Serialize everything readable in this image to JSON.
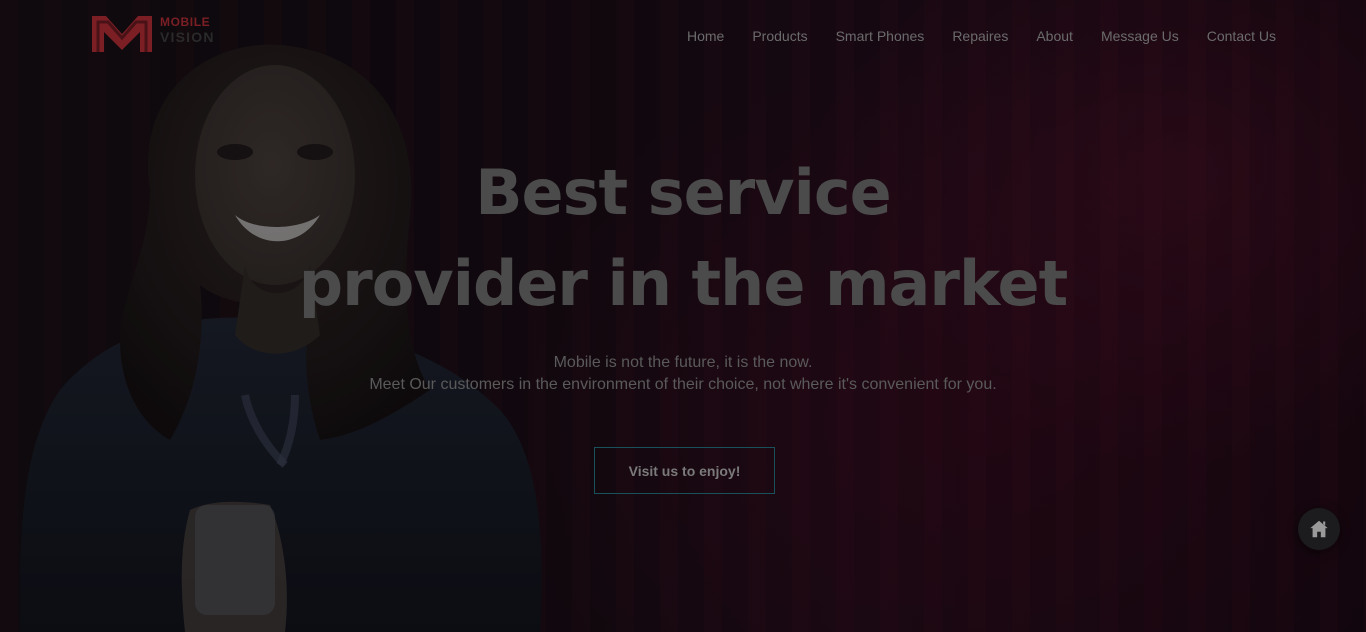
{
  "brand": {
    "top_text": "MOBILE",
    "bottom_text": "VISION",
    "logo_icon": "m-logo-icon",
    "accent_color": "#7b1f25"
  },
  "nav": {
    "items": [
      {
        "label": "Home"
      },
      {
        "label": "Products"
      },
      {
        "label": "Smart Phones"
      },
      {
        "label": "Repaires"
      },
      {
        "label": "About"
      },
      {
        "label": "Message Us"
      },
      {
        "label": "Contact Us"
      }
    ]
  },
  "hero": {
    "headline_line1": "Best service",
    "headline_line2": "provider in the market",
    "subtext_line1": "Mobile is not the future, it is the now.",
    "subtext_line2": "Meet Our customers in the environment of their choice, not where it's convenient for you.",
    "cta_label": "Visit us to enjoy!",
    "cta_border_color": "#19515b"
  },
  "floating_button": {
    "icon": "home-icon"
  }
}
